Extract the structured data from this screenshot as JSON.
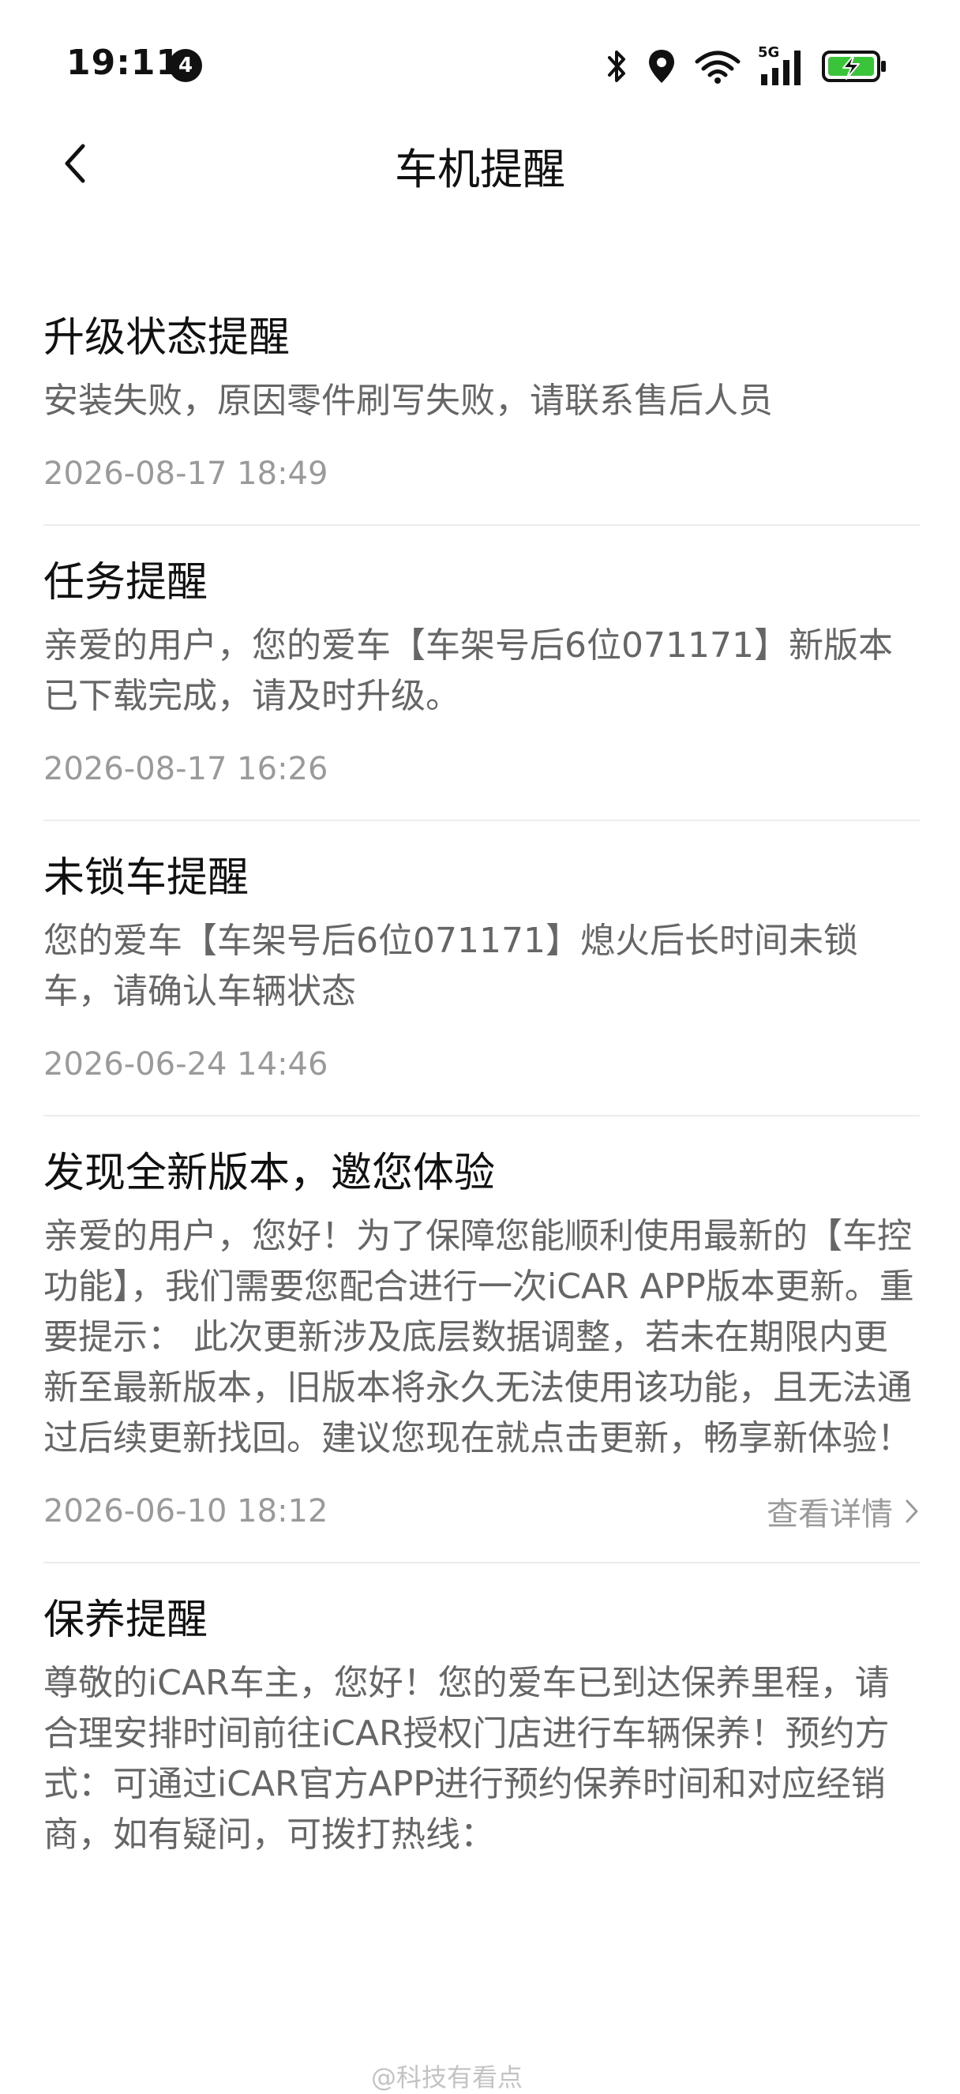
{
  "status_bar": {
    "time": "19:11",
    "notification_count": "4",
    "network_label": "5G"
  },
  "header": {
    "title": "车机提醒"
  },
  "notifications": [
    {
      "title": "升级状态提醒",
      "body": "安装失败，原因零件刷写失败，请联系售后人员",
      "time": "2026-08-17 18:49"
    },
    {
      "title": "任务提醒",
      "body": "亲爱的用户，您的爱车【车架号后6位071171】新版本已下载完成，请及时升级。",
      "time": "2026-08-17 16:26"
    },
    {
      "title": "未锁车提醒",
      "body": "您的爱车【车架号后6位071171】熄火后长时间未锁车，请确认车辆状态",
      "time": "2026-06-24 14:46"
    },
    {
      "title": "发现全新版本，邀您体验",
      "body": "亲爱的用户，您好！为了保障您能顺利使用最新的【车控功能】，我们需要您配合进行一次iCAR APP版本更新。重要提示： 此次更新涉及底层数据调整，若未在期限内更新至最新版本，旧版本将永久无法使用该功能，且无法通过后续更新找回。建议您现在就点击更新，畅享新体验！",
      "time": "2026-06-10 18:12",
      "link_label": "查看详情"
    },
    {
      "title": "保养提醒",
      "body": "尊敬的iCAR车主，您好！您的爱车已到达保养里程，请合理安排时间前往iCAR授权门店进行车辆保养！预约方式：可通过iCAR官方APP进行预约保养时间和对应经销商，如有疑问，可拨打热线："
    }
  ],
  "watermark": "@科技有看点"
}
